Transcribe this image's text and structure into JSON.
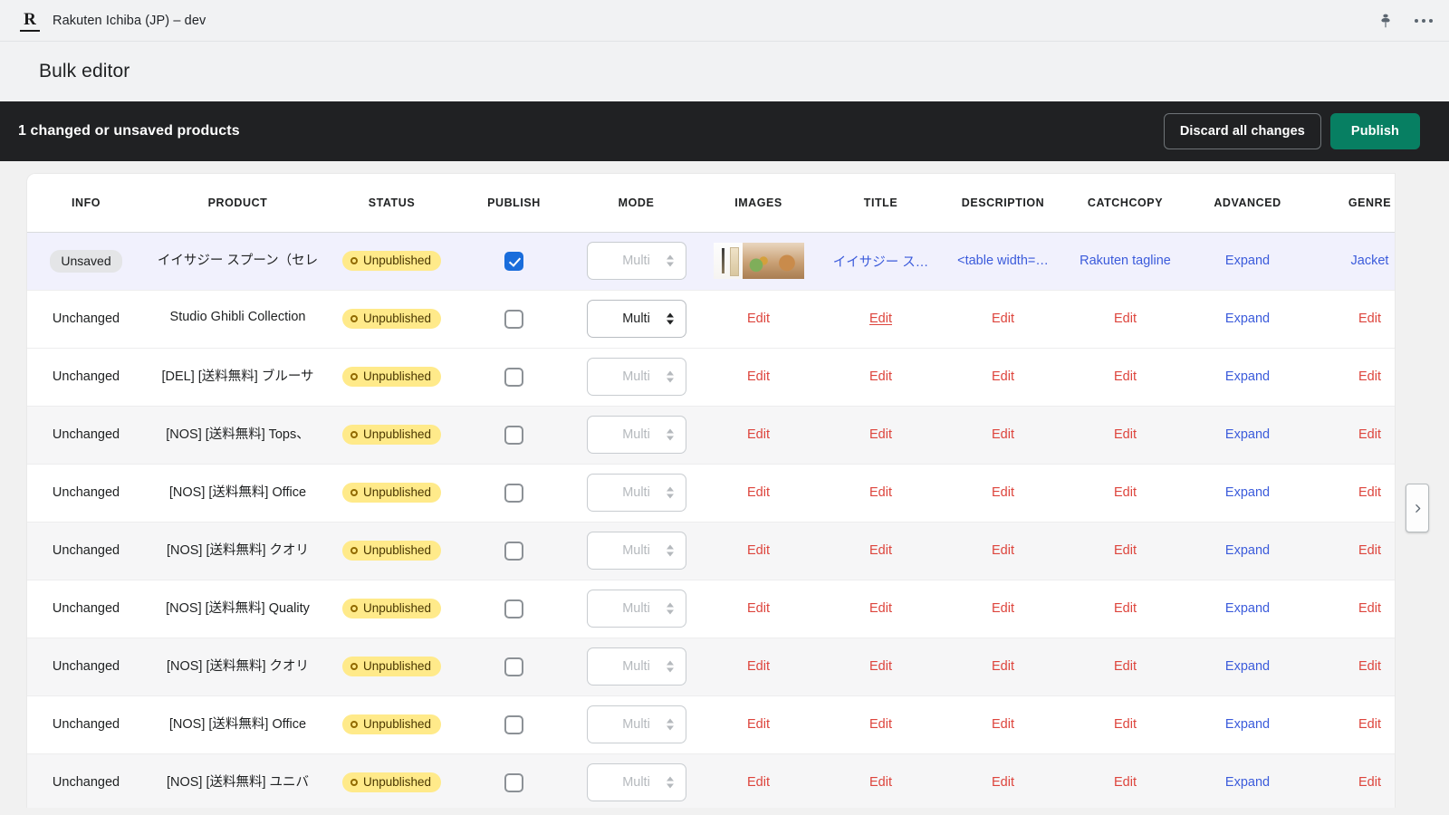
{
  "appbar": {
    "logo_letter": "R",
    "title": "Rakuten Ichiba (JP) – dev",
    "pin_icon": "pin-icon",
    "more_icon": "more-options-icon"
  },
  "page": {
    "title": "Bulk editor"
  },
  "banner": {
    "message": "1 changed or unsaved products",
    "discard_label": "Discard all changes",
    "publish_label": "Publish",
    "background": "#202123",
    "publish_color": "#077f62"
  },
  "table": {
    "columns": [
      "INFO",
      "PRODUCT",
      "STATUS",
      "PUBLISH",
      "MODE",
      "IMAGES",
      "TITLE",
      "DESCRIPTION",
      "CATCHCOPY",
      "ADVANCED",
      "GENRE"
    ],
    "rows": [
      {
        "info": "Unsaved",
        "product": "イイサジー スプーン（セレ",
        "status": "Unpublished",
        "publish_checked": true,
        "mode": "Multi",
        "images": "thumbnails",
        "title": "イイサジー ス…",
        "description": "<table width=…",
        "catchcopy": "Rakuten tagline",
        "advanced": "Expand",
        "genre": "Jacket",
        "state": "selected"
      },
      {
        "info": "Unchanged",
        "product": "Studio Ghibli Collection",
        "status": "Unpublished",
        "publish_checked": false,
        "mode": "Multi",
        "images": "Edit",
        "title": "Edit",
        "description": "Edit",
        "catchcopy": "Edit",
        "advanced": "Expand",
        "genre": "Edit",
        "state": "white",
        "mode_active": true,
        "title_hover": true
      },
      {
        "info": "Unchanged",
        "product": "[DEL] [送料無料] ブルーサ",
        "status": "Unpublished",
        "publish_checked": false,
        "mode": "Multi",
        "images": "Edit",
        "title": "Edit",
        "description": "Edit",
        "catchcopy": "Edit",
        "advanced": "Expand",
        "genre": "Edit",
        "state": "white"
      },
      {
        "info": "Unchanged",
        "product": "[NOS] [送料無料] Tops、",
        "status": "Unpublished",
        "publish_checked": false,
        "mode": "Multi",
        "images": "Edit",
        "title": "Edit",
        "description": "Edit",
        "catchcopy": "Edit",
        "advanced": "Expand",
        "genre": "Edit",
        "state": "alt"
      },
      {
        "info": "Unchanged",
        "product": "[NOS] [送料無料] Office",
        "status": "Unpublished",
        "publish_checked": false,
        "mode": "Multi",
        "images": "Edit",
        "title": "Edit",
        "description": "Edit",
        "catchcopy": "Edit",
        "advanced": "Expand",
        "genre": "Edit",
        "state": "white"
      },
      {
        "info": "Unchanged",
        "product": "[NOS] [送料無料] クオリ",
        "status": "Unpublished",
        "publish_checked": false,
        "mode": "Multi",
        "images": "Edit",
        "title": "Edit",
        "description": "Edit",
        "catchcopy": "Edit",
        "advanced": "Expand",
        "genre": "Edit",
        "state": "alt"
      },
      {
        "info": "Unchanged",
        "product": "[NOS] [送料無料] Quality",
        "status": "Unpublished",
        "publish_checked": false,
        "mode": "Multi",
        "images": "Edit",
        "title": "Edit",
        "description": "Edit",
        "catchcopy": "Edit",
        "advanced": "Expand",
        "genre": "Edit",
        "state": "white"
      },
      {
        "info": "Unchanged",
        "product": "[NOS] [送料無料] クオリ",
        "status": "Unpublished",
        "publish_checked": false,
        "mode": "Multi",
        "images": "Edit",
        "title": "Edit",
        "description": "Edit",
        "catchcopy": "Edit",
        "advanced": "Expand",
        "genre": "Edit",
        "state": "alt"
      },
      {
        "info": "Unchanged",
        "product": "[NOS] [送料無料] Office",
        "status": "Unpublished",
        "publish_checked": false,
        "mode": "Multi",
        "images": "Edit",
        "title": "Edit",
        "description": "Edit",
        "catchcopy": "Edit",
        "advanced": "Expand",
        "genre": "Edit",
        "state": "white"
      },
      {
        "info": "Unchanged",
        "product": "[NOS] [送料無料] ユニバ",
        "status": "Unpublished",
        "publish_checked": false,
        "mode": "Multi",
        "images": "Edit",
        "title": "Edit",
        "description": "Edit",
        "catchcopy": "Edit",
        "advanced": "Expand",
        "genre": "Edit",
        "state": "alt"
      }
    ]
  },
  "scroll_next_icon": "chevron-right-icon"
}
